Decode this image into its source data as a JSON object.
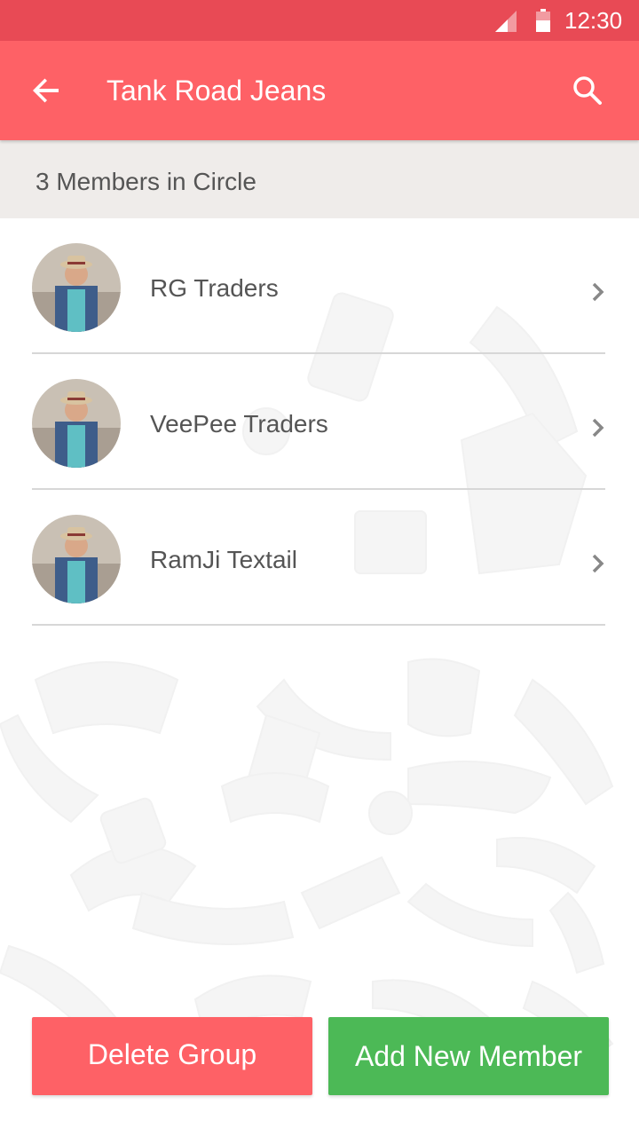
{
  "status_bar": {
    "time": "12:30",
    "signal_icon": "cell-signal-icon",
    "battery_icon": "battery-icon",
    "color": "#e84a55"
  },
  "app_bar": {
    "title": "Tank Road Jeans",
    "back_icon": "arrow-back-icon",
    "search_icon": "search-icon",
    "color": "#fe6166"
  },
  "members_header": {
    "text": "3 Members in Circle"
  },
  "members": [
    {
      "name": "RG Traders"
    },
    {
      "name": "VeePee Traders"
    },
    {
      "name": "RamJi Textail"
    }
  ],
  "actions": {
    "delete_label": "Delete Group",
    "delete_color": "#fe6166",
    "add_label": "Add New Member",
    "add_color": "#4cb956"
  }
}
